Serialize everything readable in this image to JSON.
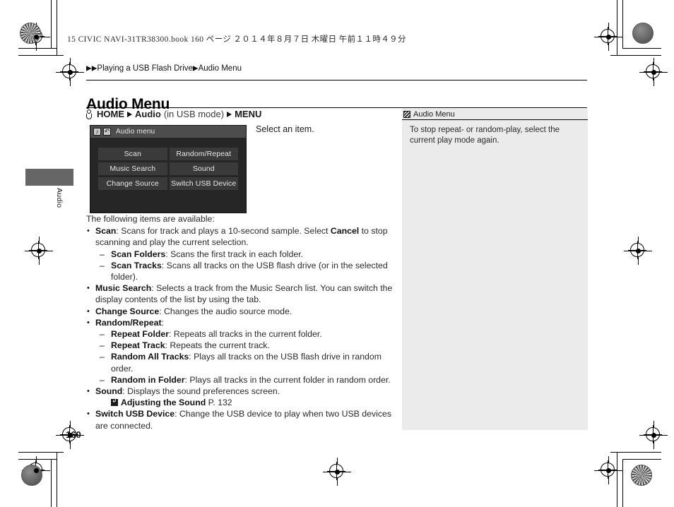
{
  "print": {
    "header_code": "15 CIVIC NAVI-31TR38300.book   160 ページ   ２０１４年８月７日   木曜日   午前１１時４９分"
  },
  "breadcrumb": {
    "marker1": "▶",
    "marker2": "▶",
    "section": "Playing a USB Flash Drive",
    "marker3": "▶",
    "subsection": "Audio Menu"
  },
  "page_title": "Audio Menu",
  "nav_path": {
    "home": "HOME",
    "audio": "Audio",
    "mode": "(in USB mode)",
    "menu": "MENU"
  },
  "device": {
    "title": "Audio menu",
    "icon_note": "music-note-icon",
    "icon_back": "return-arrow-icon",
    "buttons": [
      "Scan",
      "Random/Repeat",
      "Music Search",
      "Sound",
      "Change Source",
      "Switch USB Device"
    ]
  },
  "select_hint": "Select an item.",
  "body": {
    "lead": "The following items are available:",
    "items": [
      {
        "term": "Scan",
        "desc_before": ": Scans for track and plays a 10-second sample. Select ",
        "emphasis": "Cancel",
        "desc_after": " to stop scanning and play the current selection.",
        "sub": [
          {
            "term": "Scan Folders",
            "desc": ": Scans the first track in each folder."
          },
          {
            "term": "Scan Tracks",
            "desc": ": Scans all tracks on the USB flash drive (or in the selected folder)."
          }
        ]
      },
      {
        "term": "Music Search",
        "desc": ": Selects a track from the Music Search list. You can switch the display contents of the list by using the tab."
      },
      {
        "term": "Change Source",
        "desc": ": Changes the audio source mode."
      },
      {
        "term": "Random/Repeat",
        "desc": ":",
        "sub": [
          {
            "term": "Repeat Folder",
            "desc": ": Repeats all tracks in the current folder."
          },
          {
            "term": "Repeat Track",
            "desc": ": Repeats the current track."
          },
          {
            "term": "Random All Tracks",
            "desc": ": Plays all tracks on the USB flash drive in random order."
          },
          {
            "term": "Random in Folder",
            "desc": ": Plays all tracks in the current folder in random order."
          }
        ]
      },
      {
        "term": "Sound",
        "desc": ": Displays the sound preferences screen.",
        "xref": {
          "label": "Adjusting the Sound",
          "page": "P. 132"
        }
      },
      {
        "term": "Switch USB Device",
        "desc": ": Change the USB device to play when two USB devices are connected."
      }
    ]
  },
  "note": {
    "title": "Audio Menu",
    "text": "To stop repeat- or random-play, select the current play mode again."
  },
  "side_tab": {
    "label": "Audio"
  },
  "page_number": "160",
  "colors": {
    "device_bg": "#262626",
    "device_titlebar": "#4d4d4d",
    "device_button": "#3a3a3a",
    "note_bg": "#ebebeb",
    "tab_block": "#666666"
  }
}
